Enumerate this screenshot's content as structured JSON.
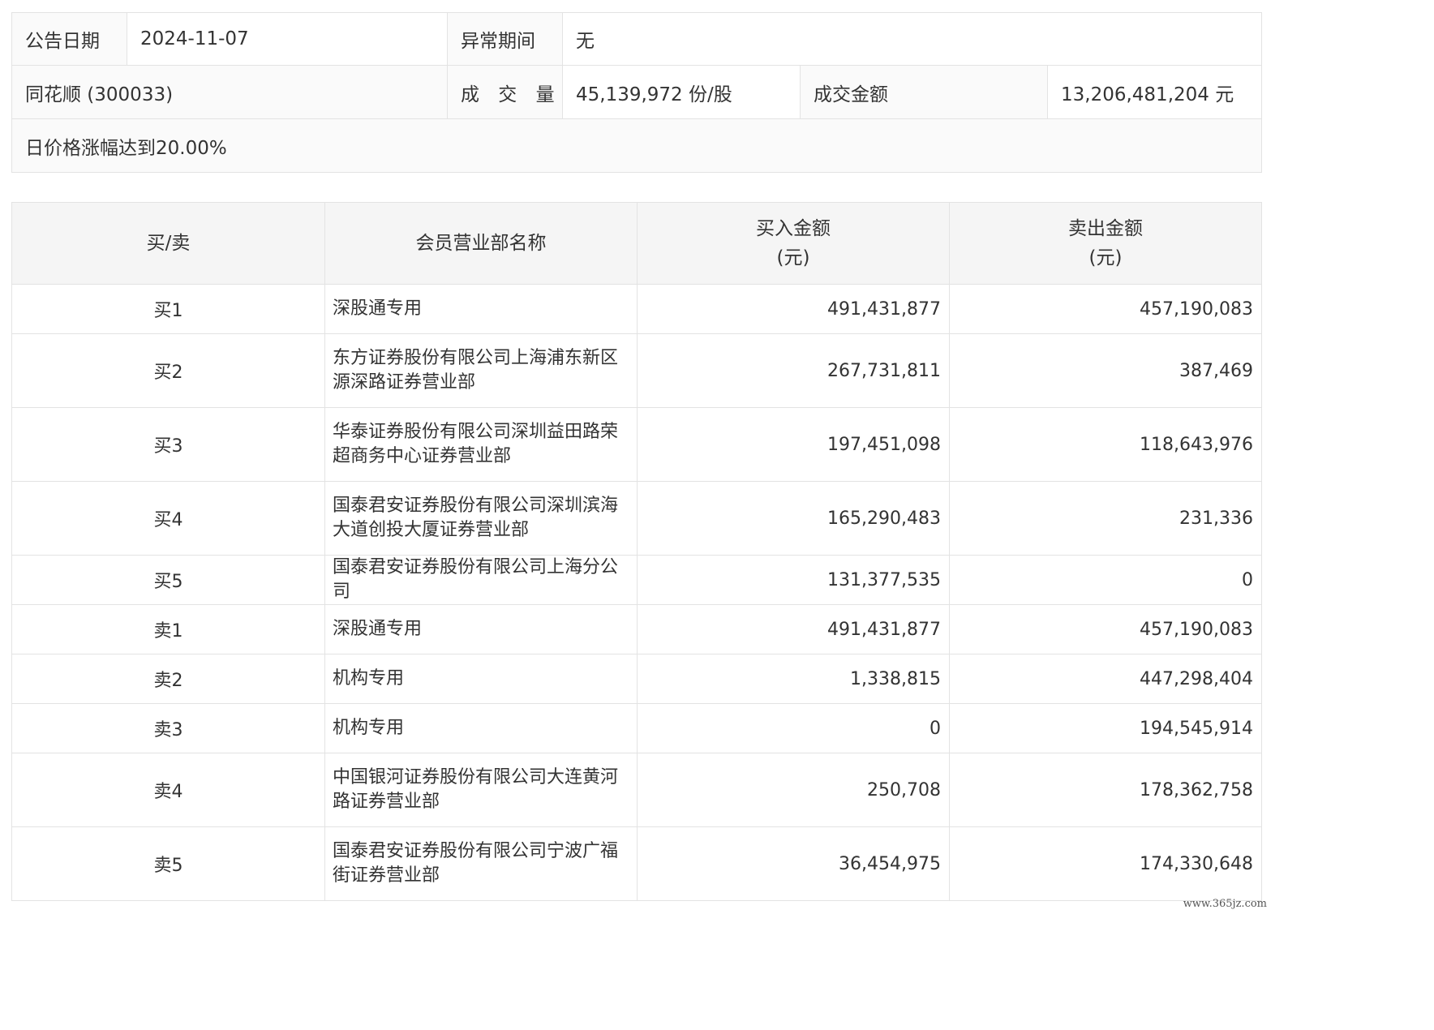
{
  "summary": {
    "announce_date_label": "公告日期",
    "announce_date": "2024-11-07",
    "abnormal_period_label": "异常期间",
    "abnormal_period": "无",
    "stock": "同花顺 (300033)",
    "volume_label": "成 交 量",
    "volume": "45,139,972 份/股",
    "amount_label": "成交金额",
    "amount": "13,206,481,204 元",
    "reason": "日价格涨幅达到20.00%"
  },
  "table": {
    "headers": {
      "side": "买/卖",
      "name": "会员营业部名称",
      "buy_line1": "买入金额",
      "buy_line2": "(元)",
      "sell_line1": "卖出金额",
      "sell_line2": "(元)"
    },
    "rows": [
      {
        "side": "买1",
        "name": "深股通专用",
        "buy": "491,431,877",
        "sell": "457,190,083"
      },
      {
        "side": "买2",
        "name": "东方证券股份有限公司上海浦东新区源深路证券营业部",
        "buy": "267,731,811",
        "sell": "387,469"
      },
      {
        "side": "买3",
        "name": "华泰证券股份有限公司深圳益田路荣超商务中心证券营业部",
        "buy": "197,451,098",
        "sell": "118,643,976"
      },
      {
        "side": "买4",
        "name": "国泰君安证券股份有限公司深圳滨海大道创投大厦证券营业部",
        "buy": "165,290,483",
        "sell": "231,336"
      },
      {
        "side": "买5",
        "name": "国泰君安证券股份有限公司上海分公司",
        "buy": "131,377,535",
        "sell": "0"
      },
      {
        "side": "卖1",
        "name": "深股通专用",
        "buy": "491,431,877",
        "sell": "457,190,083"
      },
      {
        "side": "卖2",
        "name": "机构专用",
        "buy": "1,338,815",
        "sell": "447,298,404"
      },
      {
        "side": "卖3",
        "name": "机构专用",
        "buy": "0",
        "sell": "194,545,914"
      },
      {
        "side": "卖4",
        "name": "中国银河证券股份有限公司大连黄河路证券营业部",
        "buy": "250,708",
        "sell": "178,362,758"
      },
      {
        "side": "卖5",
        "name": "国泰君安证券股份有限公司宁波广福街证券营业部",
        "buy": "36,454,975",
        "sell": "174,330,648"
      }
    ]
  },
  "watermark": "www.365jz.com"
}
